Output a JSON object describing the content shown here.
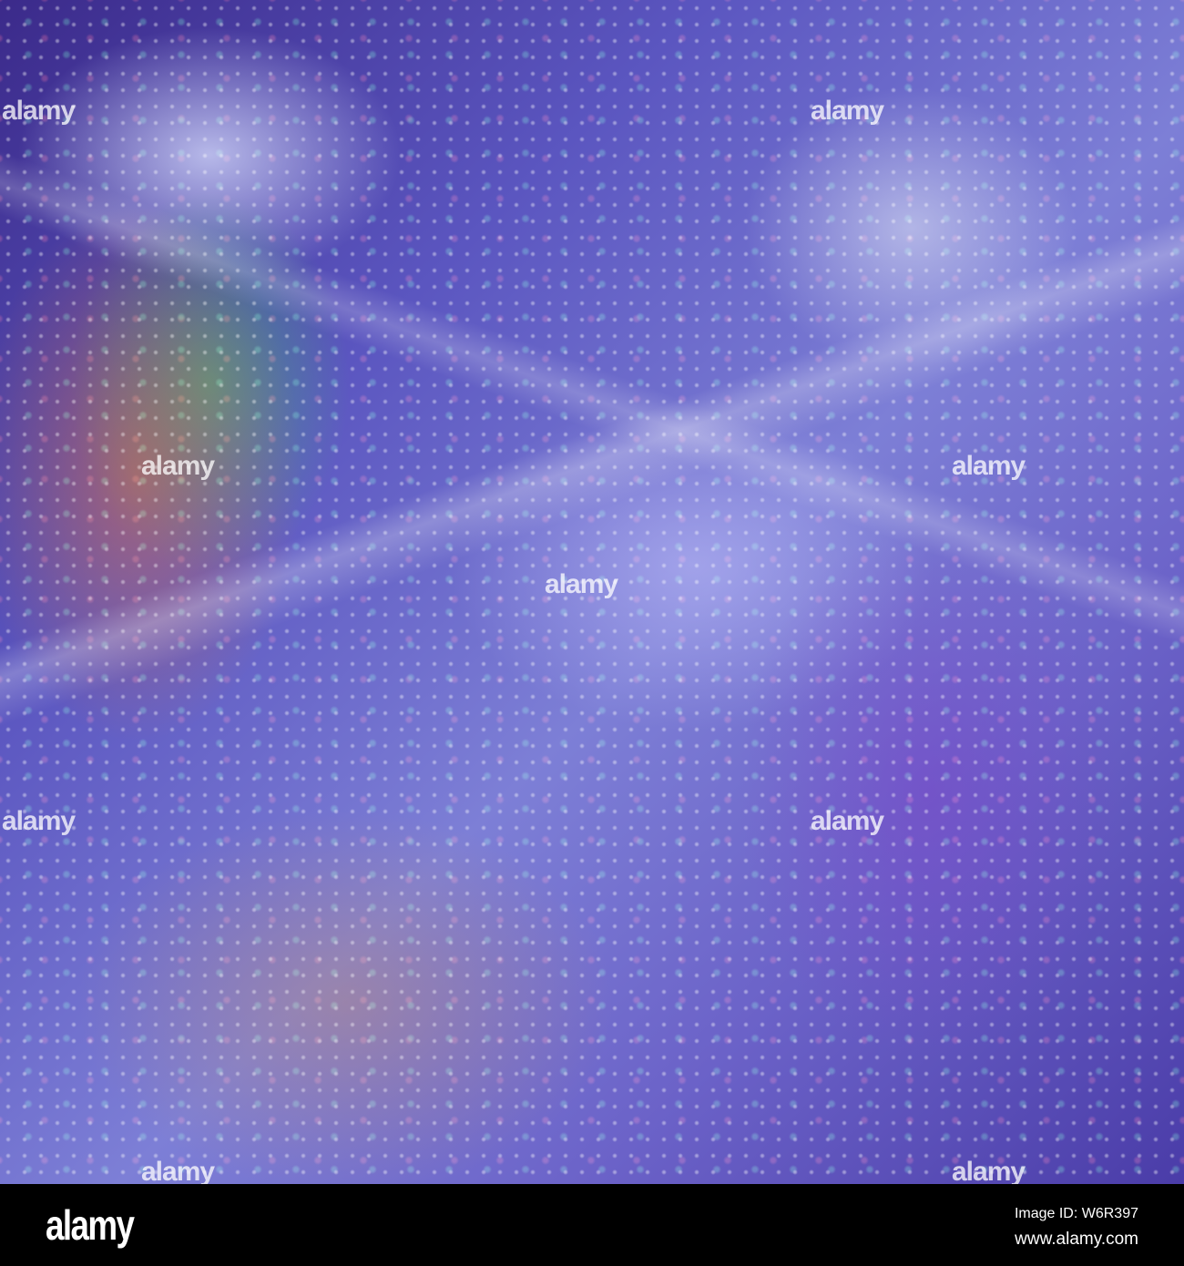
{
  "watermark": {
    "text": "alamy"
  },
  "footer": {
    "logo": "alamy",
    "image_id": "Image ID: W6R397",
    "url": "www.alamy.com"
  }
}
